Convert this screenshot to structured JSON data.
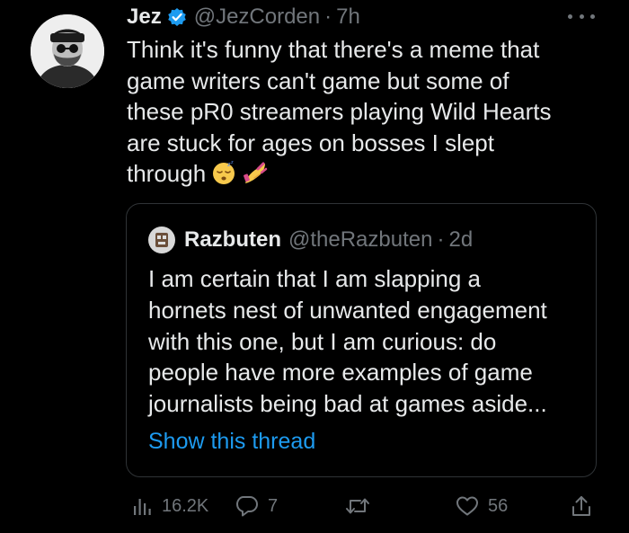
{
  "tweet": {
    "author_name": "Jez",
    "author_handle": "@JezCorden",
    "separator": "·",
    "time": "7h",
    "text_lines": [
      "Think it's funny that there's a meme that",
      "game writers can't game but some of",
      "these pR0 streamers playing Wild Hearts",
      "are stuck for ages on bosses I slept",
      "through"
    ],
    "emojis": [
      "sleeping-face-emoji",
      "nail-polish-emoji"
    ]
  },
  "quote": {
    "author_name": "Razbuten",
    "author_handle": "@theRazbuten",
    "separator": "·",
    "time": "2d",
    "text_lines": [
      "I am certain that I am slapping a",
      "hornets nest of unwanted engagement",
      "with this one, but I am curious: do",
      "people have more examples of game",
      "journalists being bad at games aside..."
    ],
    "show_thread": "Show this thread"
  },
  "actions": {
    "views": "16.2K",
    "replies": "7",
    "retweets": "",
    "likes": "56"
  },
  "colors": {
    "background": "#000000",
    "text": "#e7e9ea",
    "muted": "#71767b",
    "accent": "#1d9bf0",
    "border": "#2f3336"
  }
}
